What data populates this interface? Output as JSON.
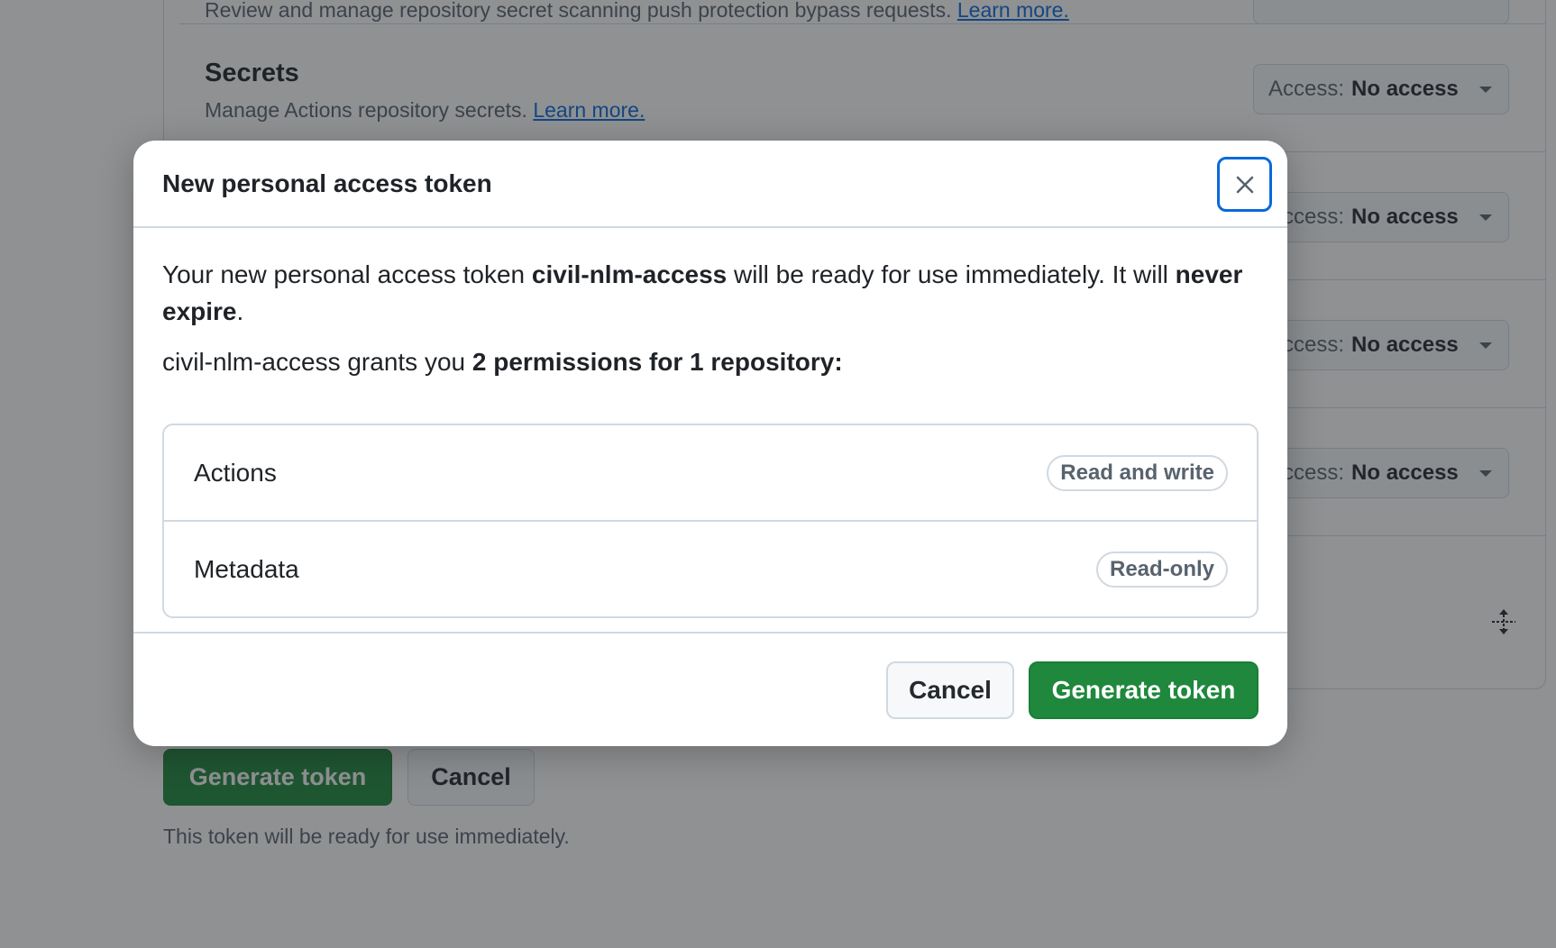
{
  "background": {
    "top_row": {
      "description": "Review and manage repository secret scanning push protection bypass requests.",
      "link": "Learn more."
    },
    "secrets_row": {
      "title": "Secrets",
      "description": "Manage Actions repository secrets.",
      "link": "Learn more.",
      "access_prefix": "Access:",
      "access_value": "No access"
    },
    "hidden_rows": [
      {
        "access_prefix": "Access:",
        "access_value": "No access"
      },
      {
        "access_prefix": "Access:",
        "access_value": "No access"
      },
      {
        "access_prefix": "Access:",
        "access_value": "No access"
      }
    ],
    "generate_label": "Generate token",
    "cancel_label": "Cancel",
    "note": "This token will be ready for use immediately."
  },
  "dialog": {
    "title": "New personal access token",
    "intro": {
      "part1": "Your new personal access token ",
      "token_name": "civil-nlm-access",
      "part2": " will be ready for use immediately. It will ",
      "expiry": "never expire",
      "part3": "."
    },
    "grants": {
      "part1": "civil-nlm-access grants you ",
      "summary": "2 permissions for 1 repository:"
    },
    "permissions": [
      {
        "name": "Actions",
        "level": "Read and write"
      },
      {
        "name": "Metadata",
        "level": "Read-only"
      }
    ],
    "cancel_label": "Cancel",
    "generate_label": "Generate token"
  },
  "colors": {
    "primary_green": "#1f883d",
    "focus_blue": "#0969da",
    "border": "#d1d9e0",
    "muted_text": "#59636e"
  }
}
